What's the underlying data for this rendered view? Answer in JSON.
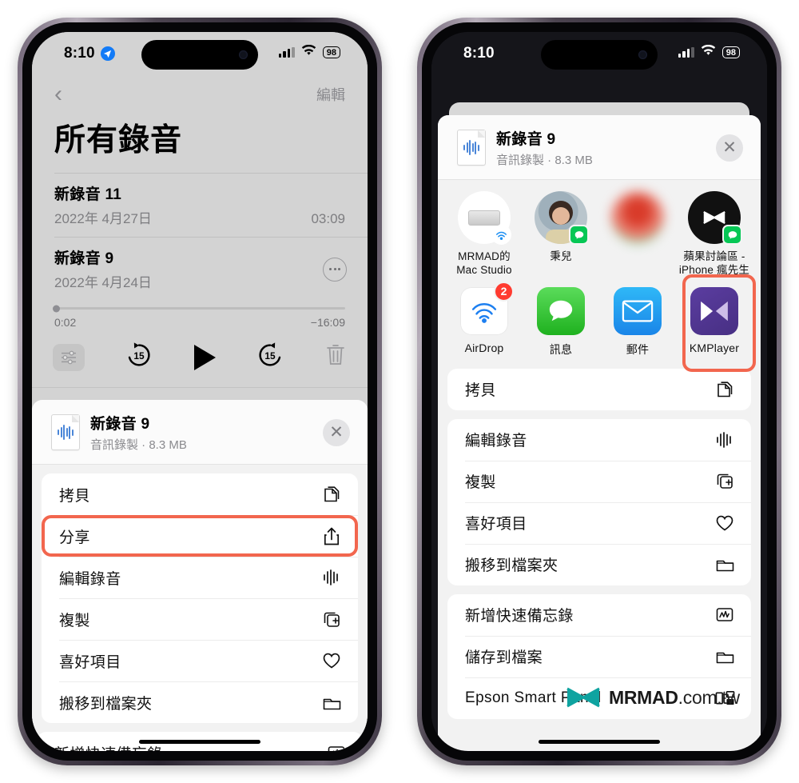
{
  "status_bar": {
    "time": "8:10",
    "battery": "98",
    "location_icon": "location-arrow-icon",
    "cellular_icon": "signal-bars-icon",
    "wifi_icon": "wifi-icon"
  },
  "left_phone": {
    "nav": {
      "back_icon": "chevron-left-icon",
      "edit_label": "編輯"
    },
    "title": "所有錄音",
    "recordings": [
      {
        "name": "新錄音 11",
        "date": "2022年 4月27日",
        "duration": "03:09"
      },
      {
        "name": "新錄音 9",
        "date": "2022年 4月24日",
        "duration": ""
      }
    ],
    "player": {
      "elapsed": "0:02",
      "remaining": "−16:09",
      "eq_icon": "equalizer-icon",
      "back15_icon": "rewind-15-icon",
      "play_icon": "play-icon",
      "fwd15_icon": "forward-15-icon",
      "trash_icon": "trash-icon"
    },
    "sheet": {
      "file_title": "新錄音 9",
      "file_subtitle": "音訊錄製 · 8.3 MB",
      "file_icon": "audio-waveform-document-icon",
      "close_icon": "close-icon",
      "groups": [
        {
          "items": [
            {
              "label": "拷貝",
              "icon": "copy-icon",
              "highlighted": false
            },
            {
              "label": "分享",
              "icon": "share-icon",
              "highlighted": true
            },
            {
              "label": "編輯錄音",
              "icon": "waveform-icon",
              "highlighted": false
            },
            {
              "label": "複製",
              "icon": "duplicate-icon",
              "highlighted": false
            },
            {
              "label": "喜好項目",
              "icon": "heart-icon",
              "highlighted": false
            },
            {
              "label": "搬移到檔案夾",
              "icon": "folder-icon",
              "highlighted": false
            }
          ]
        },
        {
          "items": [
            {
              "label": "新增快速備忘錄",
              "icon": "quick-note-icon",
              "highlighted": false
            }
          ]
        }
      ]
    }
  },
  "right_phone": {
    "sheet": {
      "file_title": "新錄音 9",
      "file_subtitle": "音訊錄製 · 8.3 MB",
      "file_icon": "audio-waveform-document-icon",
      "close_icon": "close-icon"
    },
    "people": [
      {
        "name": "MRMAD的\nMac Studio",
        "badge": "airdrop",
        "avatar": "mac-studio"
      },
      {
        "name": "秉兒",
        "badge": "line",
        "avatar": "photo-person"
      },
      {
        "name": "",
        "badge": "line",
        "avatar": "blurred-photo"
      },
      {
        "name": "蘋果討論區 -\niPhone 瘋先生",
        "badge": "line",
        "avatar": "black-logo"
      },
      {
        "name": "",
        "badge": "",
        "avatar": "partial-photo"
      }
    ],
    "apps": [
      {
        "name": "AirDrop",
        "icon": "airdrop-icon",
        "badge": "2",
        "highlighted": false
      },
      {
        "name": "訊息",
        "icon": "messages-icon",
        "badge": "",
        "highlighted": false
      },
      {
        "name": "郵件",
        "icon": "mail-icon",
        "badge": "",
        "highlighted": false
      },
      {
        "name": "KMPlayer",
        "icon": "kmplayer-icon",
        "badge": "",
        "highlighted": true
      },
      {
        "name": "",
        "icon": "partial-app-icon",
        "badge": "",
        "highlighted": false
      }
    ],
    "groups": [
      {
        "items": [
          {
            "label": "拷貝",
            "icon": "copy-icon"
          }
        ]
      },
      {
        "items": [
          {
            "label": "編輯錄音",
            "icon": "waveform-icon"
          },
          {
            "label": "複製",
            "icon": "duplicate-icon"
          },
          {
            "label": "喜好項目",
            "icon": "heart-icon"
          },
          {
            "label": "搬移到檔案夾",
            "icon": "folder-icon"
          }
        ]
      },
      {
        "items": [
          {
            "label": "新增快速備忘錄",
            "icon": "quick-note-icon"
          },
          {
            "label": "儲存到檔案",
            "icon": "folder-icon"
          },
          {
            "label": "Epson Smart Panel",
            "icon": "printer-icon"
          }
        ]
      }
    ]
  },
  "watermark": {
    "text": "MRMAD",
    "suffix": ".com.tw",
    "logo_icon": "mrmad-bowtie-logo",
    "color": "#0fa3a0"
  },
  "colors": {
    "highlight": "#f2664e",
    "accent_blue": "#137bf7",
    "line_green": "#06c755",
    "sheet_bg": "#f2f2f2"
  }
}
